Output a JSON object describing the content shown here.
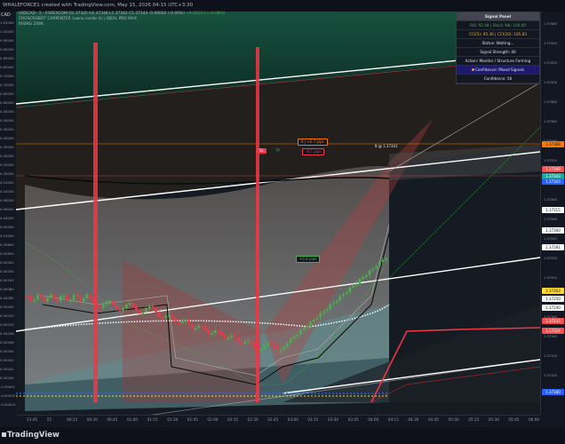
{
  "title": "WHALEFORCE1 created with TradingView.com, May 15, 2026 04:15 UTC+3:30",
  "legend": {
    "symbol_line": "USDCAD · 5 · FOREXCOM",
    "ohlc": "O1.37345 H1.37346 L1.37342 C1.37343 -0.00002 (-0.00%)",
    "extra": "+0.00114 (+0.08%)",
    "indicator1": "CROSCROBOT CARPENTER (owna inside it) | IDEAL PRO MAX",
    "indicator2": "RISING ZION"
  },
  "left_axis": {
    "currency": "CAD",
    "ticks": [
      "1.05000",
      "1.00000",
      "0.95000",
      "0.90000",
      "0.85000",
      "0.80000",
      "0.75000",
      "0.70000",
      "0.65000",
      "0.60000",
      "0.55000",
      "0.50000",
      "0.45000",
      "0.40000",
      "0.35000",
      "0.30000",
      "0.25000",
      "0.20000",
      "0.15000",
      "0.10000",
      "0.08000",
      "0.06000",
      "0.04000",
      "0.02000",
      "0.01000",
      "0.00800",
      "0.00600",
      "0.00400",
      "0.00200",
      "0.00100",
      "0.00080",
      "0.00060",
      "0.00040",
      "0.00020",
      "0.00010",
      "0.00008",
      "0.00006",
      "0.00004",
      "0.00002",
      "0.00001",
      "0.00000",
      "-0.00001",
      "-0.00002",
      "-0.00004"
    ]
  },
  "right_axis": {
    "ticks": [
      "1.37460",
      "1.37440",
      "1.37420",
      "1.37400",
      "1.37380",
      "1.37360",
      "1.37340",
      "1.37320",
      "1.37300",
      "1.37280",
      "1.37260",
      "1.37240",
      "1.37220",
      "1.37200",
      "1.37180",
      "1.37160",
      "1.37140",
      "1.37120",
      "1.37100"
    ],
    "badges": [
      {
        "label": "1.37368",
        "bg": "#f57c00",
        "fg": "#131722"
      },
      {
        "label": "1.37348",
        "bg": "#ef5350",
        "fg": "#ffffff"
      },
      {
        "label": "1.37343",
        "bg": "#26a69a",
        "fg": "#ffffff"
      },
      {
        "label": "1.37343",
        "bg": "#2962ff",
        "fg": "#ffffff"
      },
      {
        "label": "1.37315",
        "bg": "#ffffff",
        "fg": "#131722"
      },
      {
        "label": "1.37300",
        "bg": "#ffffff",
        "fg": "#131722"
      },
      {
        "label": "1.37281",
        "bg": "#ffffff",
        "fg": "#131722"
      },
      {
        "label": "1.37263",
        "bg": "#fdd835",
        "fg": "#131722"
      },
      {
        "label": "1.37250",
        "bg": "#ffffff",
        "fg": "#131722"
      },
      {
        "label": "1.37240",
        "bg": "#ffffff",
        "fg": "#131722"
      },
      {
        "label": "1.37232",
        "bg": "#ef5350",
        "fg": "#ffffff"
      },
      {
        "label": "1.37224",
        "bg": "#ef5350",
        "fg": "#ffffff"
      },
      {
        "label": "1.37180",
        "bg": "#2962ff",
        "fg": "#ffffff"
      }
    ]
  },
  "time_axis": [
    "23:45",
    "15",
    "00:15",
    "00:30",
    "00:45",
    "01:00",
    "01:15",
    "01:30",
    "01:45",
    "02:00",
    "02:15",
    "02:30",
    "02:45",
    "03:00",
    "03:15",
    "03:30",
    "03:45",
    "04:00",
    "04:15",
    "04:30",
    "04:45",
    "05:00",
    "05:15",
    "05:30",
    "05:45",
    "06:00"
  ],
  "panel": {
    "header": "Signal Panel",
    "rsi": "RSI: 92.48 | Stoch %K: 100.00",
    "cci": "CCI(5): 95.36 | CCI(20): 185.83",
    "status": "Status: Waiting...",
    "strength": "Signal Strength: 40",
    "action": "Action: Monitor / Structure Forming",
    "confidence_label": "Confidence: Mixed Signals",
    "confidence_value": "Confidence: 50"
  },
  "tags": {
    "top": "8 | +2.7 pips",
    "sl": "-0.7 pips",
    "mid": "+6.4 pips",
    "price": "8 @ 1.37341",
    "sl_label": "SL",
    "tp_label": "TP"
  },
  "footer": {
    "brand": "TradingView"
  },
  "colors": {
    "bull": "#4caf50",
    "bear": "#f23645",
    "bg": "#131722",
    "accent": "#2962ff"
  }
}
